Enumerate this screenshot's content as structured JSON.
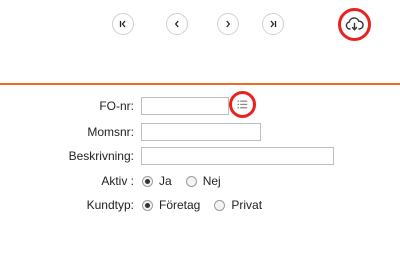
{
  "navigation": {
    "first_icon": "first-page-icon",
    "prev_icon": "previous-icon",
    "next_icon": "next-icon",
    "last_icon": "last-page-icon",
    "download_icon": "cloud-download-icon"
  },
  "accent_color": "#ef6a23",
  "highlight_color": "#e8231f",
  "form": {
    "fo_nr": {
      "label": "FO-nr:",
      "value": "",
      "lookup_icon": "list-icon"
    },
    "momsnr": {
      "label": "Momsnr:",
      "value": ""
    },
    "beskrivning": {
      "label": "Beskrivning:",
      "value": ""
    },
    "aktiv": {
      "label": "Aktiv :",
      "options": [
        "Ja",
        "Nej"
      ],
      "selected": "Ja"
    },
    "kundtyp": {
      "label": "Kundtyp:",
      "options": [
        "Företag",
        "Privat"
      ],
      "selected": "Företag"
    }
  }
}
